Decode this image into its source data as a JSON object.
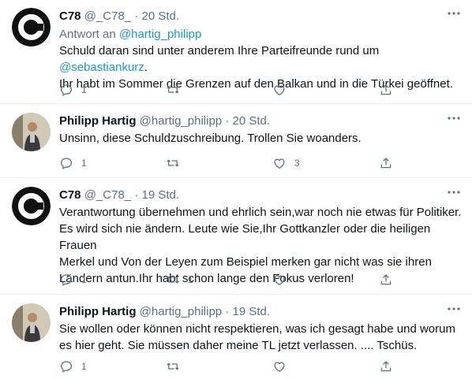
{
  "tweets": [
    {
      "name": "C78",
      "handle": "@_C78_",
      "sep": "·",
      "time": "20 Std.",
      "reply_prefix": "Antwort an ",
      "reply_handle": "@hartig_philipp",
      "text_line1_pre": "Schuld daran sind unter anderem Ihre Parteifreunde rund um ",
      "text_line1_link": "@sebastiankurz",
      "text_line1_post": ".",
      "text_line2": "Ihr habt im Sommer die Grenzen auf den Balkan und in die Türkei geöffnet.",
      "reply_count": "1",
      "retweet_count": "",
      "like_count": ""
    },
    {
      "name": "Philipp Hartig",
      "handle": "@hartig_philipp",
      "sep": "·",
      "time": "20 Std.",
      "text": "Unsinn, diese Schuldzuschreibung. Trollen Sie woanders.",
      "reply_count": "1",
      "retweet_count": "",
      "like_count": "3"
    },
    {
      "name": "C78",
      "handle": "@_C78_",
      "sep": "·",
      "time": "19 Std.",
      "lines": [
        "Verantwortung übernehmen und ehrlich sein,war noch nie etwas für Politiker.",
        "Es wird sich nie ändern. Leute wie Sie,Ihr Gottkanzler oder die heiligen Frauen",
        "Merkel und Von der Leyen zum Beispiel merken gar nicht was sie ihren",
        "Ländern antun.Ihr habt schon lange den Fokus verloren!"
      ],
      "reply_count": "1",
      "retweet_count": "1",
      "like_count": ""
    },
    {
      "name": "Philipp Hartig",
      "handle": "@hartig_philipp",
      "sep": "·",
      "time": "19 Std.",
      "lines": [
        "Sie wollen oder können nicht respektieren, was ich gesagt habe und worum",
        "es hier geht. Sie müssen daher meine TL jetzt verlassen. .... Tschüs."
      ],
      "reply_count": "1",
      "retweet_count": "",
      "like_count": ""
    }
  ],
  "colors": {
    "text": "#0f1419",
    "muted": "#5b7083",
    "link": "#1b95e0",
    "border": "#ebeef0"
  },
  "icons": [
    "more-icon",
    "reply-icon",
    "retweet-icon",
    "like-icon",
    "share-icon"
  ]
}
